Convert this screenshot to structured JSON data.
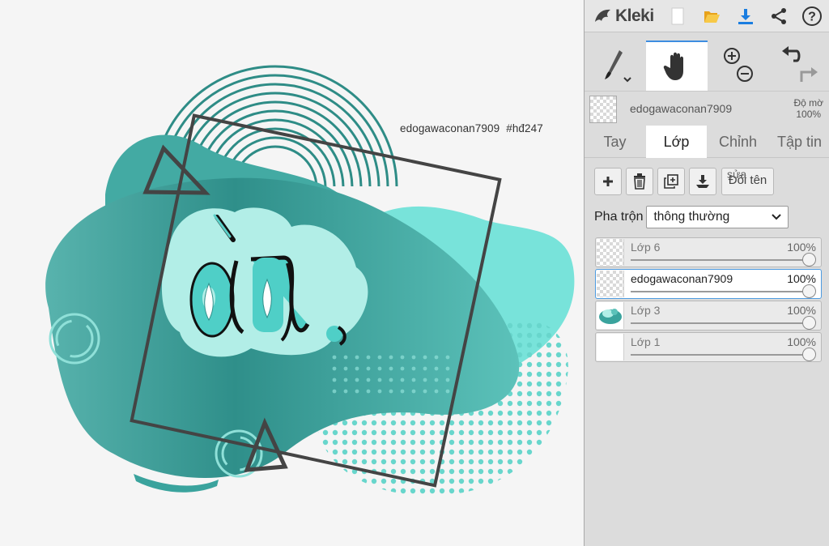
{
  "app": {
    "name": "Kleki"
  },
  "canvas": {
    "watermark_user": "edogawaconan7909",
    "watermark_tag": "#hđ247"
  },
  "toolbar": {
    "icons": [
      "new-image-icon",
      "open-folder-icon",
      "download-icon",
      "share-icon",
      "help-icon"
    ]
  },
  "tools": {
    "brush": "brush-icon",
    "hand": "hand-icon",
    "zoom_in": "zoom-in-icon",
    "zoom_out": "zoom-out-icon",
    "undo": "undo-icon",
    "redo": "redo-icon"
  },
  "current_layer": {
    "name": "edogawaconan7909",
    "opacity_label": "Độ mờ",
    "opacity_value": "100%"
  },
  "tabs": [
    {
      "label": "Tay"
    },
    {
      "label": "Lớp"
    },
    {
      "label": "Chỉnh"
    },
    {
      "label": "Tập tin"
    }
  ],
  "active_tab": "Lớp",
  "layer_actions": {
    "rename_label": "Đổi tên",
    "rename_overlay": "sửa"
  },
  "blend": {
    "label": "Pha trộn",
    "value": "thông thường"
  },
  "layers": [
    {
      "name": "Lớp 6",
      "opacity": "100%",
      "selected": false
    },
    {
      "name": "edogawaconan7909",
      "opacity": "100%",
      "selected": true
    },
    {
      "name": "Lớp 3",
      "opacity": "100%",
      "selected": false
    },
    {
      "name": "Lớp 1",
      "opacity": "100%",
      "selected": false
    }
  ],
  "colors": {
    "teal_dark": "#2f8f8a",
    "teal_mid": "#5bc4bd",
    "teal_light": "#7fe0d8",
    "mint": "#b6efe9",
    "accent_blue": "#3d8de0"
  }
}
